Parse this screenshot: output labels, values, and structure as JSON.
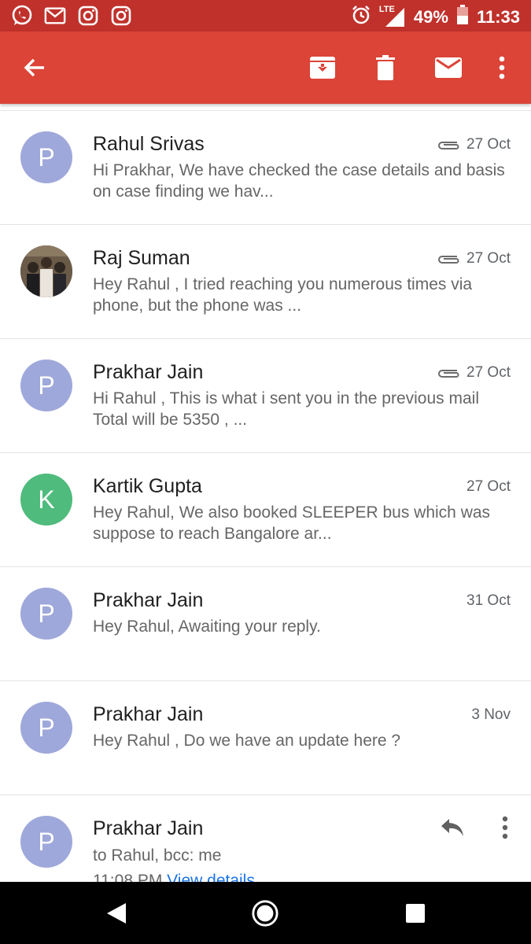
{
  "status_bar": {
    "battery": "49%",
    "time": "11:33",
    "network": "LTE",
    "left_icons": [
      "whatsapp-icon",
      "gmail-icon",
      "instagram-icon",
      "instagram-icon"
    ]
  },
  "toolbar": {
    "icons": [
      "back-arrow-icon",
      "archive-icon",
      "delete-icon",
      "mark-unread-icon",
      "more-vert-icon"
    ]
  },
  "messages": [
    {
      "initial": "P",
      "sender": "Rahul Srivas",
      "date": "27 Oct",
      "attachment": true,
      "snippet": "Hi Prakhar, We have checked the case details and basis on case finding we hav...",
      "avatar_color": "#9fa8da"
    },
    {
      "initial": "",
      "sender": "Raj Suman",
      "date": "27 Oct",
      "attachment": true,
      "snippet": "Hey Rahul , I tried reaching you numerous times via phone, but the phone was ...",
      "avatar_color": "#5b4a3a"
    },
    {
      "initial": "P",
      "sender": "Prakhar Jain",
      "date": "27 Oct",
      "attachment": true,
      "snippet": "Hi Rahul , This is what i sent you in the previous mail Total will be 5350 , ...",
      "avatar_color": "#9fa8da"
    },
    {
      "initial": "K",
      "sender": "Kartik Gupta",
      "date": "27 Oct",
      "attachment": false,
      "snippet": "Hey Rahul, We also booked SLEEPER bus which was suppose to reach Bangalore ar...",
      "avatar_color": "#4fbb7c"
    },
    {
      "initial": "P",
      "sender": "Prakhar Jain",
      "date": "31 Oct",
      "attachment": false,
      "snippet": "Hey Rahul, Awaiting your reply.",
      "avatar_color": "#9fa8da"
    },
    {
      "initial": "P",
      "sender": "Prakhar Jain",
      "date": "3 Nov",
      "attachment": false,
      "snippet": "Hey Rahul , Do we have an update here ?",
      "avatar_color": "#9fa8da"
    }
  ],
  "open_message": {
    "initial": "P",
    "sender": "Prakhar Jain",
    "recipients": "to Rahul, bcc: me",
    "time": "11:08 PM",
    "view_details": "View details",
    "avatar_color": "#9fa8da"
  },
  "nav_bar": {
    "icons": [
      "back-triangle-icon",
      "home-circle-icon",
      "recents-square-icon"
    ]
  },
  "colors": {
    "toolbar": "#db4437",
    "status_bar": "#c0312b",
    "link": "#1a73e8"
  }
}
